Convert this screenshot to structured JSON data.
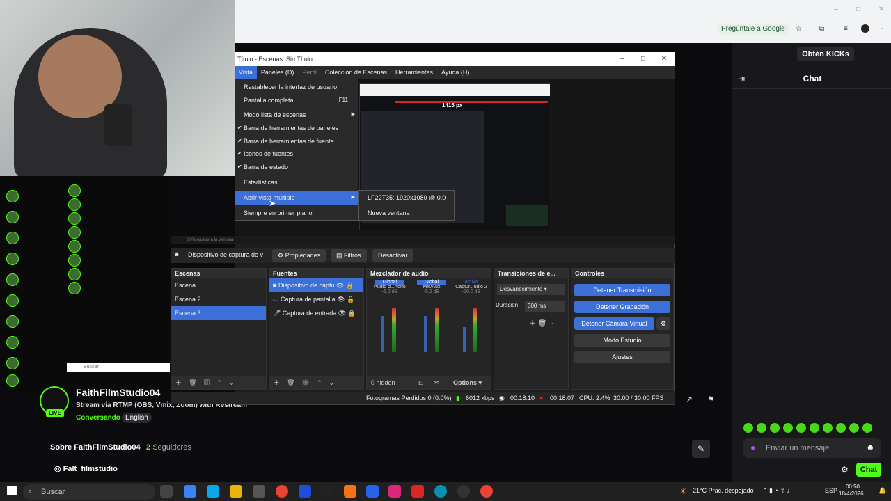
{
  "browser": {
    "google_chip": "Pregúntale a Google"
  },
  "kick": {
    "get_kicks": "Obtén KICKs",
    "chat_title": "Chat",
    "message_placeholder": "Enviar un mensaje",
    "chat_button": "Chat"
  },
  "channel": {
    "name": "FaithFilmStudio04",
    "title": "Stream via RTMP (OBS, Vmix, Zoom) with Restream",
    "category": "Conversando",
    "language": "English",
    "live": "LIVE",
    "about": "Sobre FaithFilmStudio04",
    "followers_count": "2",
    "followers_label": "Seguidores",
    "instagram": "Falt_filmstudio"
  },
  "obs": {
    "title": "Título - Escenas: Sin Título",
    "menu": [
      "Vista",
      "Paneles (D)",
      "Perfil",
      "Colección de Escenas",
      "Herramientas",
      "Ayuda (H)"
    ],
    "preview_label": "1415 px",
    "source_name": "Dispositivo de captura de v",
    "properties": "Propiedades",
    "filters": "Filtros",
    "deactivate": "Desactivar",
    "scenes_title": "Escenas",
    "scenes": [
      "Escena",
      "Escena 2",
      "Escena 3"
    ],
    "sources_title": "Fuentes",
    "sources": [
      "Dispositivo de captu",
      "Captura de pantalla",
      "Captura de entrada"
    ],
    "mixer_title": "Mezclador de audio",
    "mixer_channels": [
      {
        "name": "Audio d...rtorio",
        "db": "-5.2 dB",
        "badge": "Global"
      },
      {
        "name": "Mic/Aux",
        "db": "-5.2 dB",
        "badge": "Global"
      },
      {
        "name": "Captur...udio 2",
        "db": "-20.0 dB",
        "badge": "Activo"
      }
    ],
    "hidden": "0 hidden",
    "options": "Options",
    "transitions_title": "Transiciones de e...",
    "transition": "Desvanecimiento",
    "duration_label": "Duración",
    "duration_value": "300 ms",
    "controls_title": "Controles",
    "stop_stream": "Detener Transmisión",
    "stop_record": "Detener Grabación",
    "stop_vcam": "Detener Cámara Virtual",
    "studio_mode": "Modo Estudio",
    "settings": "Ajustes",
    "status": {
      "dropped": "Fotogramas Perdidos 0 (0.0%)",
      "bitrate": "6012 kbps",
      "stream_time": "00:18:10",
      "rec_time": "00:18:07",
      "cpu": "CPU: 2.4%",
      "fps": "30.00 / 30.00 FPS"
    },
    "zoom_text": "29%   Ajustar a la ventana"
  },
  "menu_vista": [
    {
      "label": "Restablecer la interfaz de usuario",
      "check": false
    },
    {
      "label": "Pantalla completa",
      "shortcut": "F11",
      "check": false
    },
    {
      "label": "Modo lista de escenas",
      "check": false,
      "submenu": true
    },
    {
      "label": "Barra de herramientas de paneles",
      "check": true
    },
    {
      "label": "Barra de herramientas de fuente",
      "check": true
    },
    {
      "label": "Iconos de fuentes",
      "check": true
    },
    {
      "label": "Barra de estado",
      "check": true
    },
    {
      "label": "Estadísticas",
      "check": false
    },
    {
      "label": "Abrir vista múltiple",
      "check": false,
      "submenu": true,
      "highlighted": true
    },
    {
      "label": "Siempre en primer plano",
      "check": false
    }
  ],
  "submenu_multiview": [
    "LF22T35: 1920x1080 @ 0,0",
    "Nueva ventana"
  ],
  "taskbar": {
    "search": "Buscar",
    "weather": "21°C  Prac. despejado",
    "lang": "ESP",
    "time": "00:50",
    "date": "18/4/2026"
  },
  "colors": {
    "kick_green": "#53fc18",
    "obs_blue": "#3c6fd8"
  }
}
